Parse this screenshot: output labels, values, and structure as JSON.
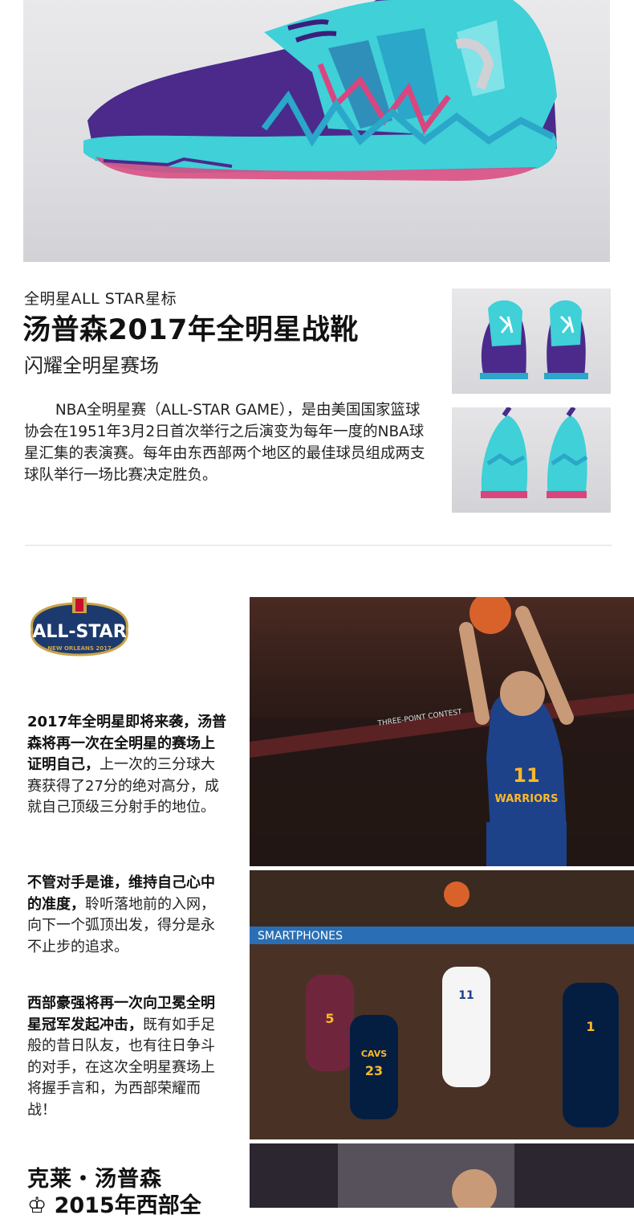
{
  "hero": {
    "image": "anta-klay-thompson-allstar-sneaker-side-view"
  },
  "product": {
    "kicker": "全明星ALL STAR星标",
    "headline": "汤普森2017年全明星战靴",
    "subhead": "闪耀全明星赛场",
    "intro": "NBA全明星赛（ALL-STAR GAME），是由美国国家篮球协会在1951年3月2日首次举行之后演变为每年一度的NBA球星汇集的表演赛。每年由东西部两个地区的最佳球员组成两支球队举行一场比赛决定胜负。"
  },
  "thumbnails": [
    "sneaker-front-pair",
    "sneaker-back-pair"
  ],
  "logo": {
    "text": "ALL-STAR",
    "subtext": "NEW ORLEANS 2017"
  },
  "story": {
    "p1_bold": "2017年全明星即将来袭，汤普森将再一次在全明星的赛场上证明自己，",
    "p1_rest": "上一次的三分球大赛获得了27分的绝对高分，成就自己顶级三分射手的地位。",
    "p2_bold": "不管对手是谁，维持自己心中的准度，",
    "p2_rest": "聆听落地前的入网，向下一个弧顶出发，得分是永不止步的追求。",
    "p3_bold": "西部豪强将再一次向卫冕全明星冠军发起冲击，",
    "p3_rest": "既有如手足般的昔日队友，也有往日争斗的对手，在这次全明星赛场上将握手言和，为西部荣耀而战！"
  },
  "player": {
    "name": "克莱・汤普森",
    "line2": "♔ 2015年西部全"
  },
  "photos": {
    "photo1": {
      "jersey_team": "WARRIORS",
      "jersey_number": "11",
      "banner": "THREE-POINT CONTEST"
    },
    "photo2": {
      "banner": "SMARTPHONES",
      "cavs_text": "CAVS",
      "numbers": [
        "5",
        "23",
        "11",
        "1"
      ]
    }
  },
  "colors": {
    "shoe_purple": "#4b2a8c",
    "shoe_teal": "#3fd0d8",
    "shoe_pink": "#d9467f",
    "warriors_blue": "#1d428a",
    "warriors_gold": "#fdb927",
    "cavs_wine": "#6f263d",
    "cavs_navy": "#041e42"
  }
}
